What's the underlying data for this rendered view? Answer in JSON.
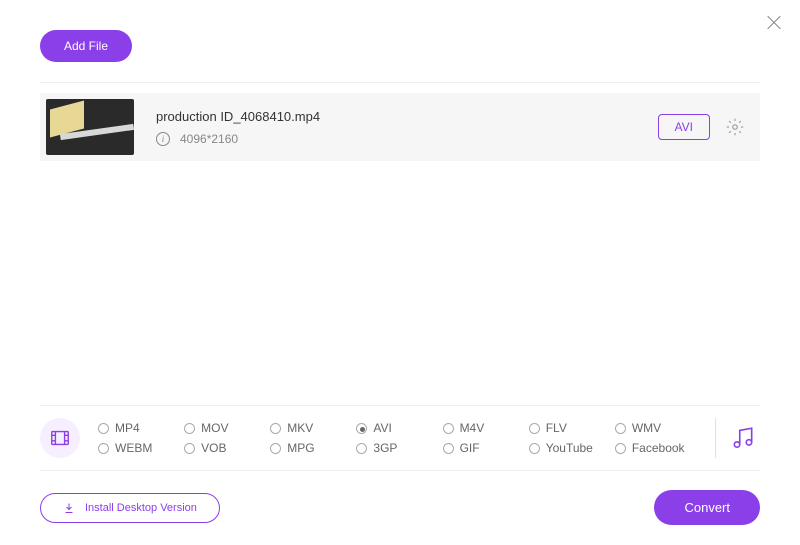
{
  "header": {
    "add_file_label": "Add File"
  },
  "file": {
    "name": "production ID_4068410.mp4",
    "resolution": "4096*2160",
    "selected_format": "AVI"
  },
  "formats": {
    "row1": [
      "MP4",
      "MOV",
      "MKV",
      "AVI",
      "M4V",
      "FLV",
      "WMV"
    ],
    "row2": [
      "WEBM",
      "VOB",
      "MPG",
      "3GP",
      "GIF",
      "YouTube",
      "Facebook"
    ],
    "selected": "AVI"
  },
  "footer": {
    "install_label": "Install Desktop Version",
    "convert_label": "Convert"
  }
}
